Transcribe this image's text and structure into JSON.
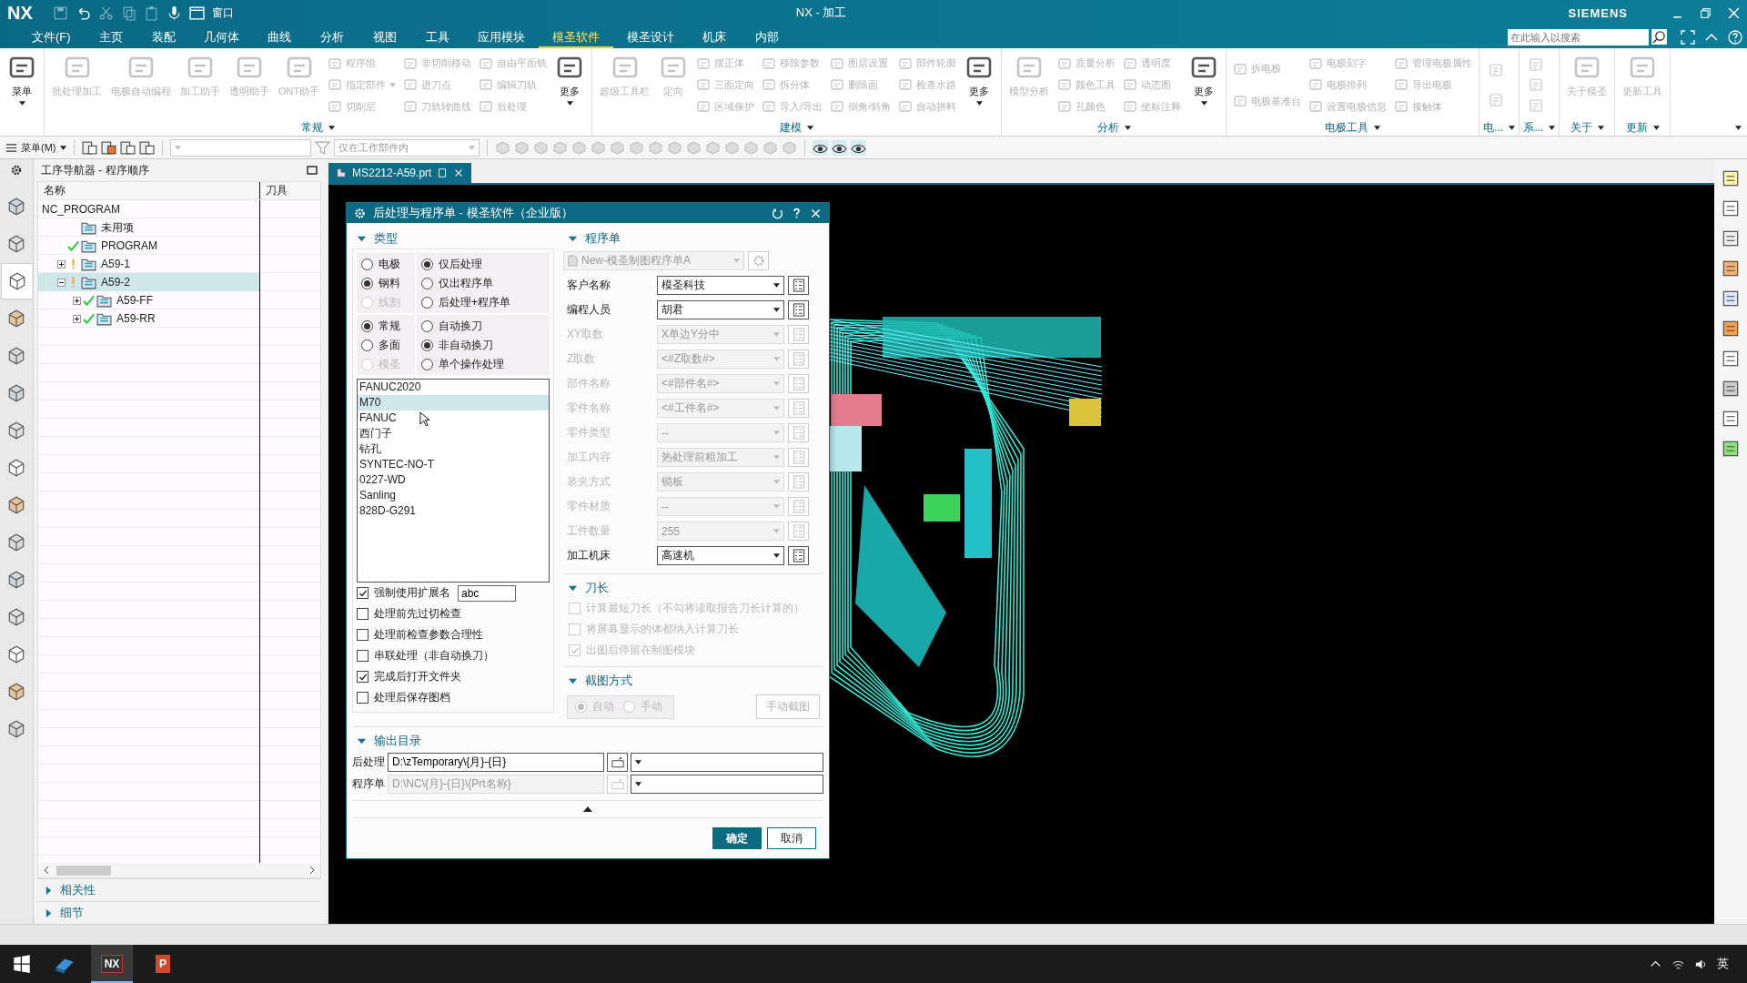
{
  "title_bar": {
    "logo": "NX",
    "quick_menu": "窗口",
    "title": "NX - 加工",
    "brand": "SIEMENS"
  },
  "menu_tabs": [
    {
      "label": "文件(F)",
      "selected": false
    },
    {
      "label": "主页",
      "selected": false
    },
    {
      "label": "装配",
      "selected": false
    },
    {
      "label": "几何体",
      "selected": false
    },
    {
      "label": "曲线",
      "selected": false
    },
    {
      "label": "分析",
      "selected": false
    },
    {
      "label": "视图",
      "selected": false
    },
    {
      "label": "工具",
      "selected": false
    },
    {
      "label": "应用模块",
      "selected": false
    },
    {
      "label": "模圣软件",
      "selected": true
    },
    {
      "label": "模圣设计",
      "selected": false
    },
    {
      "label": "机床",
      "selected": false
    },
    {
      "label": "内部",
      "selected": false
    }
  ],
  "search": {
    "placeholder": "在此输入以搜索"
  },
  "ribbon": [
    {
      "items": [
        {
          "kind": "large",
          "label": "菜单",
          "disabled": false,
          "menu": true
        }
      ]
    },
    {
      "label": "常规",
      "items": [
        {
          "kind": "large",
          "label": "批处理加工",
          "disabled": true,
          "menu": false
        },
        {
          "kind": "large",
          "label": "电极自动编程",
          "disabled": true,
          "menu": false
        },
        {
          "kind": "large",
          "label": "加工助手",
          "disabled": true,
          "menu": false
        },
        {
          "kind": "large",
          "label": "透明助手",
          "disabled": true,
          "menu": false
        },
        {
          "kind": "large",
          "label": "ONT助手",
          "disabled": true,
          "menu": false
        },
        {
          "kind": "stack",
          "items": [
            {
              "label": "程序组",
              "disabled": true,
              "menu": false
            },
            {
              "label": "指定部件",
              "disabled": true,
              "menu": true
            },
            {
              "label": "切削层",
              "disabled": true,
              "menu": false
            }
          ]
        },
        {
          "kind": "stack",
          "items": [
            {
              "label": "非切削移动",
              "disabled": true
            },
            {
              "label": "进刀点",
              "disabled": true
            },
            {
              "label": "刀轨转曲线",
              "disabled": true
            }
          ]
        },
        {
          "kind": "stack",
          "items": [
            {
              "label": "自由平面铣",
              "disabled": true
            },
            {
              "label": "编辑刀轨",
              "disabled": true
            },
            {
              "label": "后处理",
              "disabled": true
            }
          ]
        },
        {
          "kind": "large",
          "label": "更多",
          "disabled": false,
          "menu": true
        }
      ]
    },
    {
      "label": "建模",
      "items": [
        {
          "kind": "large",
          "label": "超级工具栏",
          "disabled": true,
          "menu": false
        },
        {
          "kind": "large",
          "label": "定向",
          "disabled": true,
          "menu": false
        },
        {
          "kind": "stack",
          "items": [
            {
              "label": "摆正体",
              "disabled": true
            },
            {
              "label": "三面定向",
              "disabled": true
            },
            {
              "label": "区域保护",
              "disabled": true
            }
          ]
        },
        {
          "kind": "stack",
          "items": [
            {
              "label": "移除参数",
              "disabled": true
            },
            {
              "label": "拆分体",
              "disabled": true
            },
            {
              "label": "导入/导出",
              "disabled": true
            }
          ]
        },
        {
          "kind": "stack",
          "items": [
            {
              "label": "图层设置",
              "disabled": true
            },
            {
              "label": "删除面",
              "disabled": true
            },
            {
              "label": "倒角/斜角",
              "disabled": true
            }
          ]
        },
        {
          "kind": "stack",
          "items": [
            {
              "label": "部件轮廓",
              "disabled": true
            },
            {
              "label": "检查水路",
              "disabled": true
            },
            {
              "label": "自动拼料",
              "disabled": true
            }
          ]
        },
        {
          "kind": "large",
          "label": "更多",
          "disabled": false,
          "menu": true
        }
      ]
    },
    {
      "label": "分析",
      "items": [
        {
          "kind": "large",
          "label": "模型分析",
          "disabled": true,
          "menu": false
        },
        {
          "kind": "stack",
          "items": [
            {
              "label": "质量分析",
              "disabled": true
            },
            {
              "label": "颜色工具",
              "disabled": true
            },
            {
              "label": "孔颜色",
              "disabled": true
            }
          ]
        },
        {
          "kind": "stack",
          "items": [
            {
              "label": "透明度",
              "disabled": true
            },
            {
              "label": "动态图",
              "disabled": true
            },
            {
              "label": "坐标注释",
              "disabled": true
            }
          ]
        },
        {
          "kind": "large",
          "label": "更多",
          "disabled": false,
          "menu": true
        }
      ]
    },
    {
      "label": "电极工具",
      "items": [
        {
          "kind": "stack",
          "items": [
            {
              "label": "拆电极",
              "disabled": true
            },
            {
              "label": "电极基准台",
              "disabled": true
            }
          ]
        },
        {
          "kind": "stack",
          "items": [
            {
              "label": "电极刻字",
              "disabled": true
            },
            {
              "label": "电极排列",
              "disabled": true
            },
            {
              "label": "设置电极信息",
              "disabled": true
            }
          ]
        },
        {
          "kind": "stack",
          "items": [
            {
              "label": "管理电极属性",
              "disabled": true
            },
            {
              "label": "导出电极",
              "disabled": true
            },
            {
              "label": "接触体",
              "disabled": true
            }
          ]
        }
      ]
    },
    {
      "label": "电...",
      "items": [
        {
          "kind": "icons",
          "items": [
            {
              "disabled": true
            },
            {
              "disabled": true
            }
          ]
        }
      ]
    },
    {
      "label": "系...",
      "items": [
        {
          "kind": "icons",
          "items": [
            {
              "disabled": true
            },
            {
              "disabled": true
            },
            {
              "disabled": true
            }
          ]
        }
      ]
    },
    {
      "label": "关于",
      "items": [
        {
          "kind": "large",
          "label": "关于模圣",
          "disabled": true,
          "menu": false
        }
      ]
    },
    {
      "label": "更新",
      "items": [
        {
          "kind": "large",
          "label": "更新工具",
          "disabled": true,
          "menu": false
        }
      ]
    }
  ],
  "toolbar": {
    "menu": "菜单(M)",
    "filter": "仅在工作部件内"
  },
  "file_tab": {
    "label": "MS2212-A59.prt"
  },
  "left_toolbar": [
    {
      "selected": false
    },
    {
      "selected": false
    },
    {
      "selected": true
    },
    {
      "selected": false
    },
    {
      "selected": false
    },
    {
      "selected": false
    },
    {
      "selected": false
    },
    {
      "selected": false
    },
    {
      "selected": false
    },
    {
      "selected": false
    },
    {
      "selected": false
    },
    {
      "selected": false
    },
    {
      "selected": false
    },
    {
      "selected": false
    },
    {
      "selected": false
    }
  ],
  "navigator": {
    "title": "工序导航器 - 程序顺序",
    "columns": [
      "名称",
      "刀具"
    ],
    "tree": [
      {
        "label": "NC_PROGRAM",
        "folder": false,
        "done": false,
        "warning": false,
        "selected": false,
        "children": [
          {
            "label": "未用项",
            "folder": true,
            "done": false,
            "warning": false,
            "selected": false
          },
          {
            "label": "PROGRAM",
            "folder": true,
            "done": true,
            "warning": false,
            "selected": false
          },
          {
            "label": "A59-1",
            "folder": true,
            "done": false,
            "warning": true,
            "expanded": false,
            "selected": false
          },
          {
            "label": "A59-2",
            "folder": true,
            "done": false,
            "warning": true,
            "expanded": true,
            "selected": true,
            "children": [
              {
                "label": "A59-FF",
                "folder": true,
                "done": true,
                "warning": false,
                "expanded": false,
                "selected": false
              },
              {
                "label": "A59-RR",
                "folder": true,
                "done": true,
                "warning": false,
                "expanded": false,
                "selected": false
              }
            ]
          }
        ]
      }
    ],
    "sections": [
      {
        "label": "相关性",
        "expanded": false
      },
      {
        "label": "细节",
        "expanded": false
      }
    ]
  },
  "dialog": {
    "title": "后处理与程序单 - 模圣软件（企业版）",
    "type_section": {
      "title": "类型",
      "expanded": true,
      "radio_groups": [
        [
          {
            "label": "电极",
            "selected": false,
            "disabled": false
          },
          {
            "label": "钢料",
            "selected": true,
            "disabled": false
          },
          {
            "label": "线割",
            "selected": false,
            "disabled": true
          }
        ],
        [
          {
            "label": "仅后处理",
            "selected": true,
            "disabled": false
          },
          {
            "label": "仅出程序单",
            "selected": false,
            "disabled": false
          },
          {
            "label": "后处理+程序单",
            "selected": false,
            "disabled": false
          }
        ],
        [
          {
            "label": "常规",
            "selected": true,
            "disabled": false
          },
          {
            "label": "多面",
            "selected": false,
            "disabled": false
          },
          {
            "label": "模圣",
            "selected": false,
            "disabled": true
          }
        ],
        [
          {
            "label": "自动换刀",
            "selected": false,
            "disabled": false
          },
          {
            "label": "非自动换刀",
            "selected": true,
            "disabled": false
          },
          {
            "label": "单个操作处理",
            "selected": false,
            "disabled": false
          }
        ]
      ],
      "posts": [
        {
          "label": "FANUC2020",
          "selected": false
        },
        {
          "label": "M70",
          "selected": true
        },
        {
          "label": "FANUC",
          "selected": false
        },
        {
          "label": "西门子",
          "selected": false
        },
        {
          "label": "钻孔",
          "selected": false
        },
        {
          "label": "SYNTEC-NO-T",
          "selected": false
        },
        {
          "label": "0227-WD",
          "selected": false
        },
        {
          "label": "Sanling",
          "selected": false
        },
        {
          "label": "828D-G291",
          "selected": false
        }
      ],
      "options": [
        {
          "label": "强制使用扩展名",
          "checked": true,
          "value": "abc"
        },
        {
          "label": "处理前先过切检查",
          "checked": false
        },
        {
          "label": "处理前检查参数合理性",
          "checked": false
        },
        {
          "label": "串联处理（非自动换刀）",
          "checked": false
        },
        {
          "label": "完成后打开文件夹",
          "checked": true
        },
        {
          "label": "处理后保存图档",
          "checked": false
        }
      ]
    },
    "sheet_section": {
      "title": "程序单",
      "expanded": true,
      "template": {
        "value": "New-模圣制图程序单A",
        "disabled": true
      },
      "fields": [
        {
          "label": "客户名称",
          "value": "模圣科技",
          "disabled": false
        },
        {
          "label": "编程人员",
          "value": "胡君",
          "disabled": false
        },
        {
          "label": "XY取数",
          "value": "X单边Y分中",
          "disabled": true
        },
        {
          "label": "Z取数",
          "value": "<#Z取数#>",
          "disabled": true
        },
        {
          "label": "部件名称",
          "value": "<#部件名#>",
          "disabled": true
        },
        {
          "label": "零件名称",
          "value": "<#工件名#>",
          "disabled": true
        },
        {
          "label": "零件类型",
          "value": "--",
          "disabled": true
        },
        {
          "label": "加工内容",
          "value": "热处理前粗加工",
          "disabled": true
        },
        {
          "label": "装夹方式",
          "value": "锁板",
          "disabled": true
        },
        {
          "label": "零件材质",
          "value": "--",
          "disabled": true
        },
        {
          "label": "工件数量",
          "value": "255",
          "disabled": true
        },
        {
          "label": "加工机床",
          "value": "高速机",
          "disabled": false
        }
      ]
    },
    "tool_length": {
      "title": "刀长",
      "expanded": true,
      "options": [
        {
          "label": "计算最短刀长（不勾将读取报告刀长计算的）",
          "checked": false,
          "disabled": true
        },
        {
          "label": "将屏幕显示的体都纳入计算刀长",
          "checked": false,
          "disabled": true
        },
        {
          "label": "出图后停留在制图模块",
          "checked": true,
          "disabled": true
        }
      ]
    },
    "capture": {
      "title": "截图方式",
      "expanded": true,
      "modes": [
        {
          "label": "自动",
          "selected": true,
          "disabled": true
        },
        {
          "label": "手动",
          "selected": false,
          "disabled": true
        }
      ],
      "button": {
        "label": "手动截图",
        "disabled": true
      }
    },
    "output": {
      "title": "输出目录",
      "expanded": true,
      "rows": [
        {
          "label": "后处理",
          "value": "D:\\zTemporary\\{月}-{日}",
          "disabled": false
        },
        {
          "label": "程序单",
          "value": "D:\\NC\\{月}-{日}\\{Prt名称}",
          "disabled": true
        }
      ]
    },
    "buttons": [
      {
        "label": "确定",
        "primary": true
      },
      {
        "label": "取消",
        "primary": false
      }
    ]
  },
  "taskbar": {
    "apps": [
      {
        "label": "NX",
        "active": true
      },
      {
        "label": "P",
        "active": false
      }
    ],
    "ime": "英"
  }
}
